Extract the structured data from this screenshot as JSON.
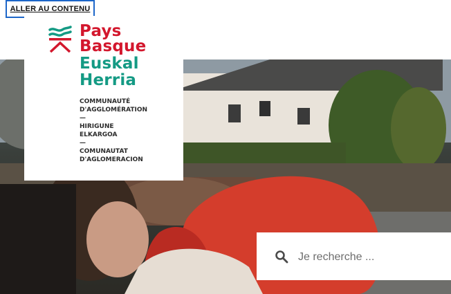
{
  "skip_link": {
    "label": "ALLER AU CONTENU"
  },
  "logo": {
    "line1": "Pays",
    "line2": "Basque",
    "line3": "Euskal",
    "line4": "Herria",
    "sub_fr": [
      "COMMUNAUTÉ",
      "D'AGGLOMÉRATION"
    ],
    "sep1": "—",
    "sub_eu": [
      "HIRIGUNE",
      "ELKARGOA"
    ],
    "sep2": "—",
    "sub_oc": [
      "COMUNAUTAT",
      "D'AGLOMERACION"
    ]
  },
  "search": {
    "placeholder": "Je recherche ..."
  },
  "colors": {
    "brand_red": "#d3172d",
    "brand_teal": "#149a84",
    "focus_blue": "#1c66c9"
  }
}
